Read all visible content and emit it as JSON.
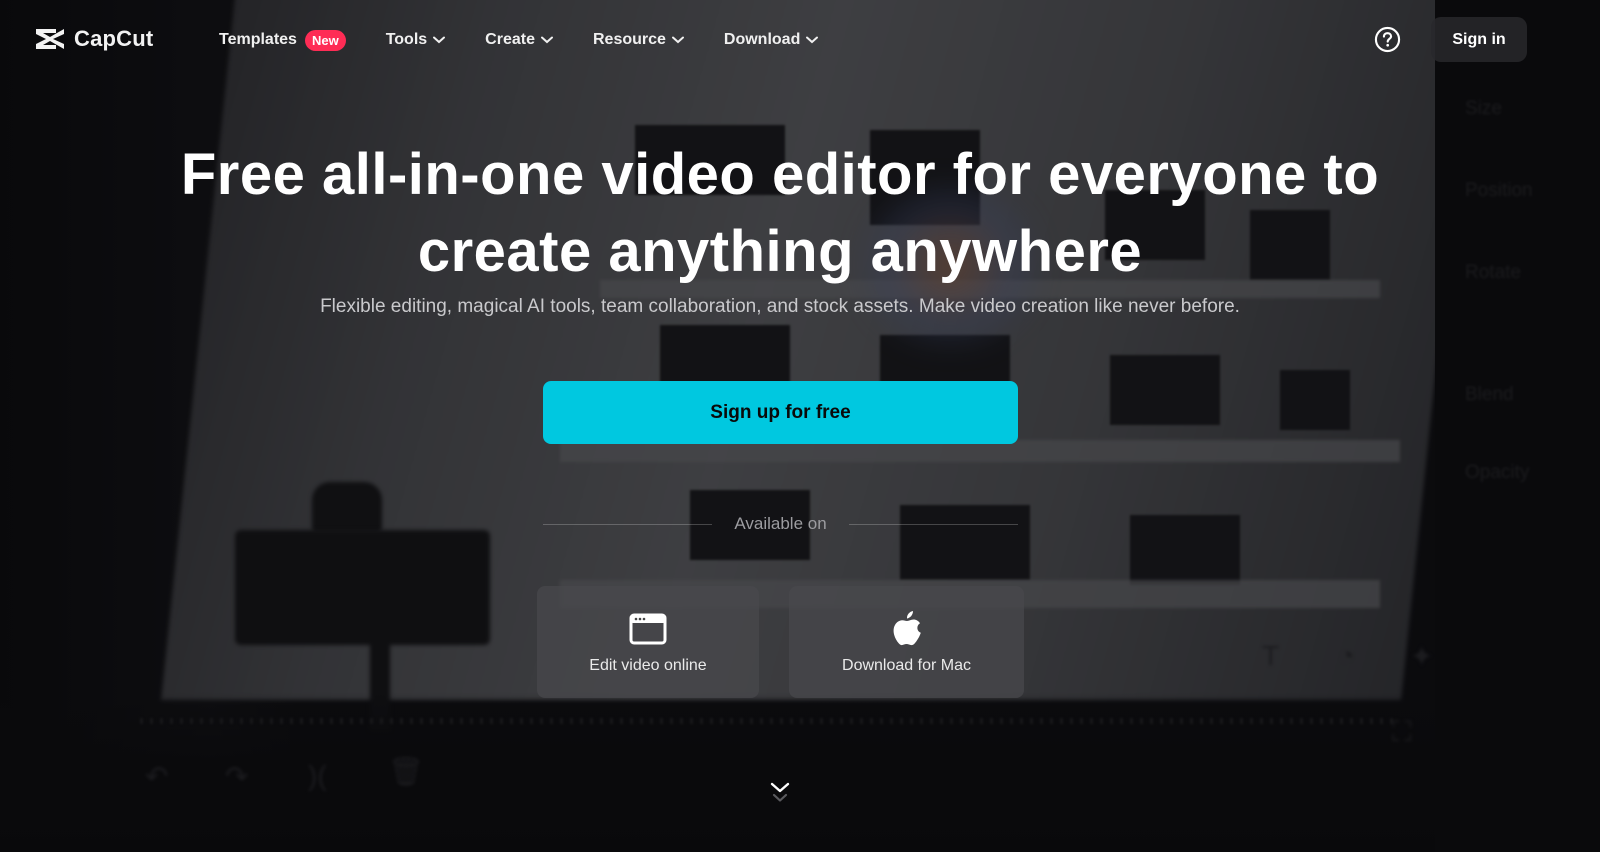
{
  "nav": {
    "brand": "CapCut",
    "items": [
      {
        "label": "Templates",
        "badge": "New",
        "has_dropdown": false
      },
      {
        "label": "Tools",
        "has_dropdown": true
      },
      {
        "label": "Create",
        "has_dropdown": true
      },
      {
        "label": "Resource",
        "has_dropdown": true
      },
      {
        "label": "Download",
        "has_dropdown": true
      }
    ],
    "help_icon": "question-circle-icon",
    "signin_label": "Sign in"
  },
  "hero": {
    "title_line1": "Free all-in-one video editor for everyone to",
    "title_line2": "create anything anywhere",
    "subtitle": "Flexible editing, magical AI tools, team collaboration, and stock assets. Make video creation like never before.",
    "cta_label": "Sign up for free",
    "available_on": "Available on",
    "platforms": [
      {
        "label": "Edit video online",
        "icon": "browser-window-icon"
      },
      {
        "label": "Download for Mac",
        "icon": "apple-icon"
      }
    ],
    "scroll_icon": "double-chevron-down-icon"
  },
  "background": {
    "panel_labels": [
      "Size",
      "Position",
      "Rotate",
      "Blend",
      "Opacity"
    ]
  },
  "colors": {
    "accent": "#00c8e0",
    "badge": "#fe2c55",
    "background": "#0b0b0d"
  }
}
